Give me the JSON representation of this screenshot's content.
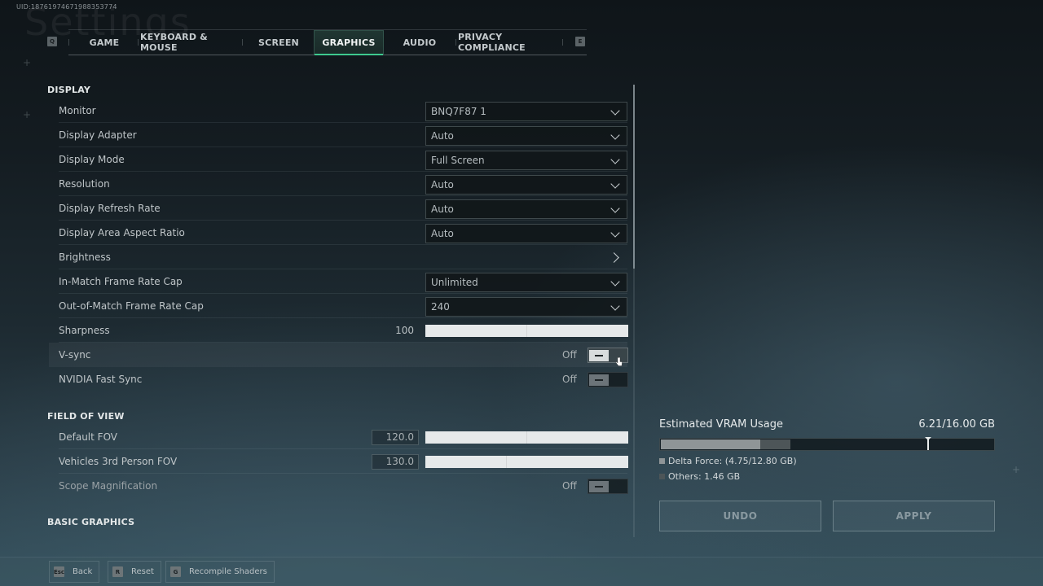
{
  "uid": "UID:18761974671988353774",
  "ghost_title": "Settings",
  "tabs": {
    "left_key": "Q",
    "right_key": "E",
    "items": [
      {
        "label": "GAME",
        "active": false
      },
      {
        "label": "KEYBOARD & MOUSE",
        "active": false
      },
      {
        "label": "SCREEN",
        "active": false
      },
      {
        "label": "GRAPHICS",
        "active": true
      },
      {
        "label": "AUDIO",
        "active": false
      },
      {
        "label": "PRIVACY COMPLIANCE",
        "active": false
      }
    ]
  },
  "sections": {
    "display": {
      "title": "DISPLAY",
      "monitor": {
        "label": "Monitor",
        "value": "BNQ7F87 1"
      },
      "display_adapter": {
        "label": "Display Adapter",
        "value": "Auto"
      },
      "display_mode": {
        "label": "Display Mode",
        "value": "Full Screen"
      },
      "resolution": {
        "label": "Resolution",
        "value": "Auto"
      },
      "refresh_rate": {
        "label": "Display Refresh Rate",
        "value": "Auto"
      },
      "aspect_ratio": {
        "label": "Display Area Aspect Ratio",
        "value": "Auto"
      },
      "brightness": {
        "label": "Brightness"
      },
      "in_match_cap": {
        "label": "In-Match Frame Rate Cap",
        "value": "Unlimited"
      },
      "out_match_cap": {
        "label": "Out-of-Match Frame Rate Cap",
        "value": "240"
      },
      "sharpness": {
        "label": "Sharpness",
        "value": "100"
      },
      "vsync": {
        "label": "V-sync",
        "value": "Off"
      },
      "fast_sync": {
        "label": "NVIDIA Fast Sync",
        "value": "Off"
      }
    },
    "fov": {
      "title": "FIELD OF VIEW",
      "default_fov": {
        "label": "Default FOV",
        "value": "120.0"
      },
      "vehicle_fov": {
        "label": "Vehicles 3rd Person FOV",
        "value": "130.0"
      },
      "scope_mag": {
        "label": "Scope Magnification",
        "value": "Off"
      }
    },
    "basic_graphics": {
      "title": "BASIC GRAPHICS"
    }
  },
  "vram": {
    "title": "Estimated VRAM Usage",
    "total": "6.21/16.00 GB",
    "used_gb": 6.21,
    "capacity_gb": 16.0,
    "game_gb": 4.75,
    "game_budget_gb": 12.8,
    "others_gb": 1.46,
    "legend_game": "Delta Force: (4.75/12.80 GB)",
    "legend_others": "Others: 1.46 GB",
    "colors": {
      "game": "#8f9597",
      "others": "#4d5558"
    }
  },
  "actions": {
    "undo": "UNDO",
    "apply": "APPLY"
  },
  "footer": {
    "back": {
      "key": "Esc",
      "label": "Back"
    },
    "reset": {
      "key": "R",
      "label": "Reset"
    },
    "recompile": {
      "key": "G",
      "label": "Recompile Shaders"
    }
  },
  "accent": "#3ec98f"
}
